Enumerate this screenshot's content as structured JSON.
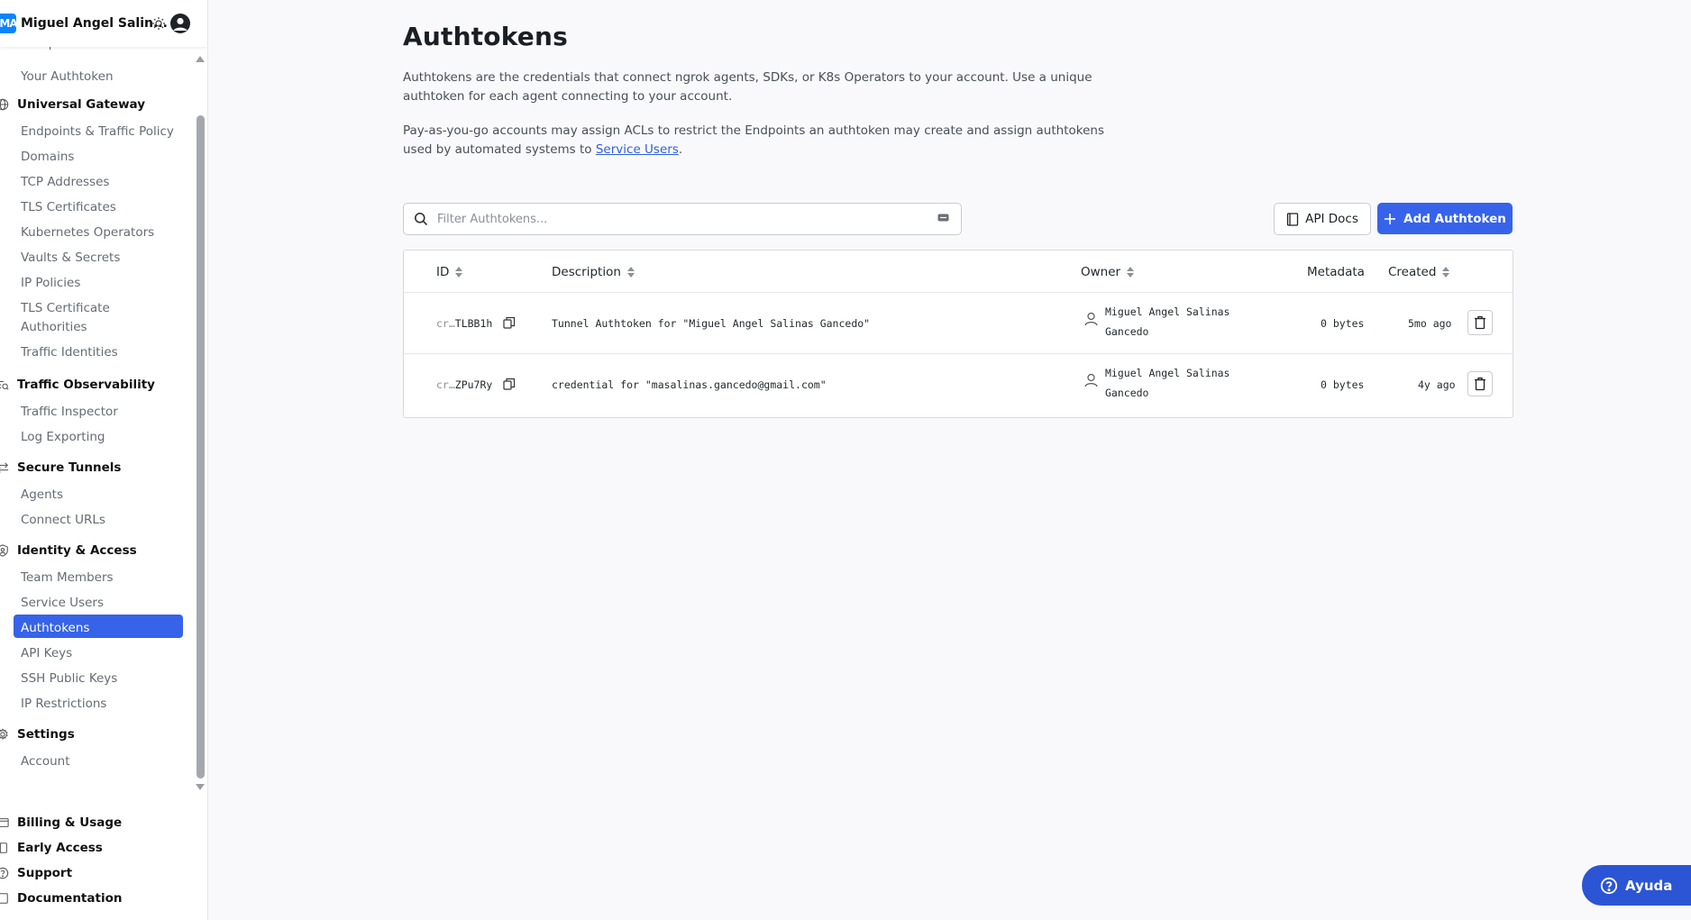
{
  "sidebar": {
    "org_avatar": "MA",
    "org_name": "Miguel Angel Salin...",
    "partial_item": "Setup & Installation",
    "your_authtoken": "Your Authtoken",
    "groups": {
      "universal_gateway": "Universal Gateway",
      "traffic_observability": "Traffic Observability",
      "secure_tunnels": "Secure Tunnels",
      "identity_access": "Identity & Access",
      "settings": "Settings"
    },
    "items": {
      "endpoints": "Endpoints & Traffic Policy",
      "domains": "Domains",
      "tcp": "TCP Addresses",
      "tls_certs": "TLS Certificates",
      "k8s": "Kubernetes Operators",
      "vaults": "Vaults & Secrets",
      "ip_policies": "IP Policies",
      "tls_ca_1": "TLS Certificate",
      "tls_ca_2": "Authorities",
      "traffic_identities": "Traffic Identities",
      "traffic_inspector": "Traffic Inspector",
      "log_exporting": "Log Exporting",
      "agents": "Agents",
      "connect_urls": "Connect URLs",
      "team_members": "Team Members",
      "service_users": "Service Users",
      "authtokens": "Authtokens",
      "api_keys": "API Keys",
      "ssh_keys": "SSH Public Keys",
      "ip_restrictions": "IP Restrictions",
      "account": "Account"
    },
    "bottom": {
      "billing": "Billing & Usage",
      "early_access": "Early Access",
      "support": "Support",
      "documentation": "Documentation"
    }
  },
  "page": {
    "title": "Authtokens",
    "desc1_line1": "Authtokens are the credentials that connect ngrok agents, SDKs, or K8s Operators to your account. Use a unique",
    "desc1_line2": "authtoken for each agent connecting to your account.",
    "desc2_line1": "Pay-as-you-go accounts may assign ACLs to restrict the Endpoints an authtoken may create and assign authtokens",
    "desc2_line2_prefix": "used by automated systems to ",
    "desc2_link": "Service Users",
    "desc2_suffix": "."
  },
  "search": {
    "placeholder": "Filter Authtokens..."
  },
  "buttons": {
    "api_docs": "API Docs",
    "add": "Add Authtoken"
  },
  "table": {
    "headers": {
      "id": "ID",
      "description": "Description",
      "owner": "Owner",
      "metadata": "Metadata",
      "created": "Created"
    },
    "rows": [
      {
        "id_prefix": "cr…",
        "id_suffix": "TLBB1h",
        "description": "Tunnel Authtoken for \"Miguel Angel Salinas Gancedo\"",
        "owner": "Miguel Angel Salinas Gancedo",
        "metadata": "0 bytes",
        "created": "5mo ago"
      },
      {
        "id_prefix": "cr…",
        "id_suffix": "ZPu7Ry",
        "description": "credential for \"masalinas.gancedo@gmail.com\"",
        "owner": "Miguel Angel Salinas Gancedo",
        "metadata": "0 bytes",
        "created": "4y ago"
      }
    ]
  },
  "help": {
    "label": "Ayuda"
  },
  "colors": {
    "accent": "#3663ea",
    "link": "#2f5fe0",
    "help": "#2c55d6"
  }
}
